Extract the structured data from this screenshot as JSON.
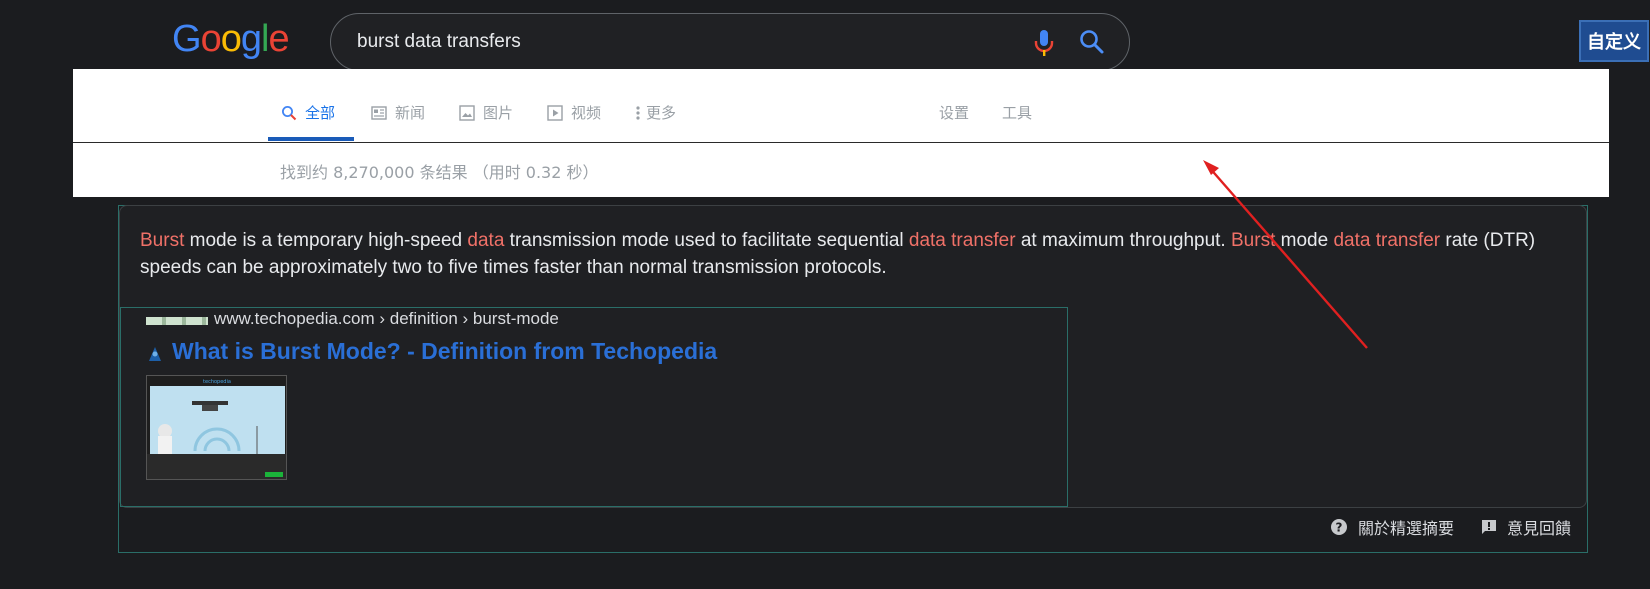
{
  "header": {
    "logo_letters": [
      "G",
      "o",
      "o",
      "g",
      "l",
      "e"
    ],
    "logo_colors": [
      "#4285f4",
      "#ea4335",
      "#fbbc05",
      "#4285f4",
      "#34a853",
      "#ea4335"
    ],
    "search_query": "burst data transfers",
    "customize_label": "自定义"
  },
  "tabs": {
    "all": "全部",
    "news": "新闻",
    "images": "图片",
    "videos": "视频",
    "more": "更多",
    "settings": "设置",
    "tools": "工具"
  },
  "stats_text": "找到约 8,270,000 条结果 （用时 0.32 秒）",
  "featured": {
    "snippet_parts": [
      {
        "text": "Burst",
        "hl": true
      },
      {
        "text": " mode is a temporary high-speed ",
        "hl": false
      },
      {
        "text": "data",
        "hl": true
      },
      {
        "text": " transmission mode used to facilitate sequential ",
        "hl": false
      },
      {
        "text": "data transfer",
        "hl": true
      },
      {
        "text": " at maximum throughput. ",
        "hl": false
      },
      {
        "text": "Burst",
        "hl": true
      },
      {
        "text": " mode ",
        "hl": false
      },
      {
        "text": "data transfer",
        "hl": true
      },
      {
        "text": " rate (DTR) speeds can be approximately two to five times faster than normal transmission protocols.",
        "hl": false
      }
    ],
    "breadcrumb": "www.techopedia.com › definition › burst-mode",
    "title": "What is Burst Mode? - Definition from Techopedia",
    "thumbnail_label": "techopedia"
  },
  "footer": {
    "about": "關於精選摘要",
    "feedback": "意見回饋"
  },
  "colors": {
    "highlight": "#f07168",
    "link": "#2a6fd6",
    "active_tab": "#1a73e8",
    "annotation_arrow": "#e02020"
  }
}
